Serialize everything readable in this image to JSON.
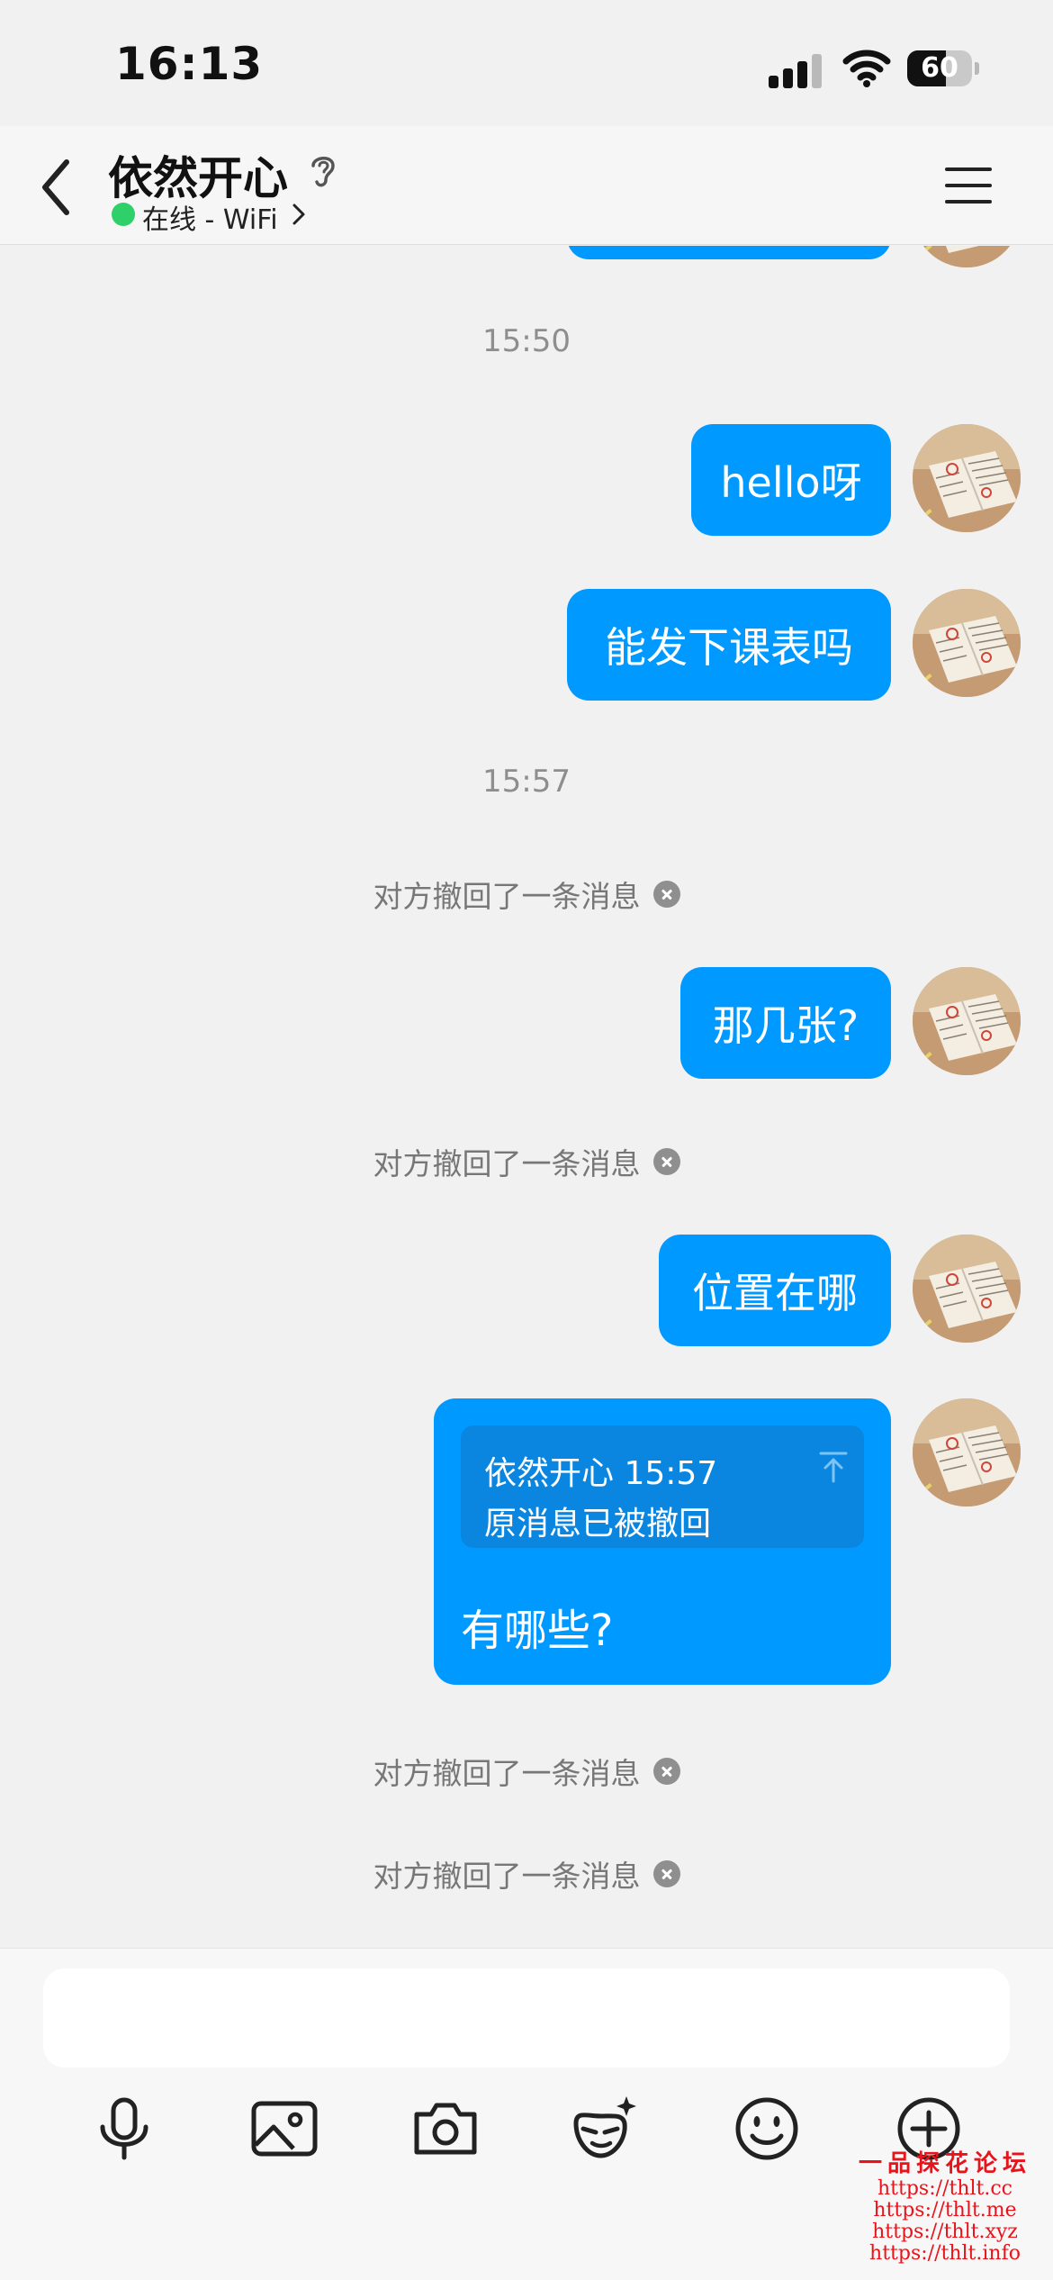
{
  "status_bar": {
    "time": "16:13",
    "battery": "60",
    "battery_level": 0.6
  },
  "header": {
    "back_icon": "chevron-left-icon",
    "contact_name": "依然开心",
    "ear_icon": "ear-icon",
    "online_status": "在线 - WiFi",
    "menu_icon": "hamburger-menu-icon"
  },
  "chat": {
    "time_1": "15:50",
    "msg_1": "hello呀",
    "msg_2": "能发下课表吗",
    "time_2": "15:57",
    "recall_1": "对方撤回了一条消息",
    "msg_3": "那几张?",
    "recall_2": "对方撤回了一条消息",
    "msg_4": "位置在哪",
    "quote": {
      "header": "依然开心 15:57",
      "body": "原消息已被撤回",
      "reply": "有哪些?"
    },
    "recall_3": "对方撤回了一条消息",
    "recall_4": "对方撤回了一条消息"
  },
  "input_bar": {
    "text_value": "",
    "tools": [
      "microphone-icon",
      "image-icon",
      "camera-icon",
      "magic-face-icon",
      "emoji-icon",
      "plus-icon"
    ]
  },
  "watermark": {
    "title": "一品探花论坛",
    "lines": [
      "https://thlt.cc",
      "https://thlt.me",
      "https://thlt.xyz",
      "https://thlt.info"
    ]
  },
  "colors": {
    "bubble": "#0099ff",
    "background": "#f1f1f1",
    "online": "#2fd06a",
    "watermark": "#e8141b"
  }
}
